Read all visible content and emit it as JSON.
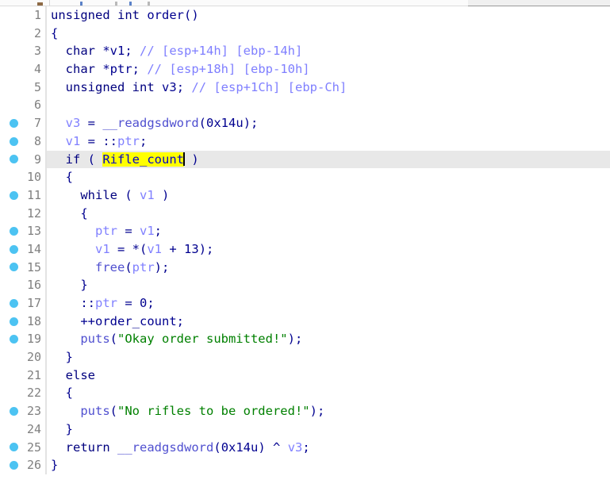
{
  "window": {
    "title": "Decompiler pseudocode view",
    "top_toolbar_visible_sliver": true
  },
  "editor": {
    "highlighted_token": "Rifle_count",
    "current_line": 9,
    "caret_after_token": true,
    "colors": {
      "background": "#ffffff",
      "current_line_highlight": "#e8e8e8",
      "breakpoint_dot": "#4cc3f2",
      "line_number": "#808080",
      "keyword": "#00007f",
      "local_variable": "#8080ff",
      "global_variable": "#8080ff",
      "function_name": "#5050d0",
      "string_literal": "#008000",
      "comment": "#7f7fff",
      "selection_highlight_bg": "#ffff00",
      "selection_highlight_fg": "#0000cc",
      "gutter_rule": "#e3e3e3"
    },
    "lines": [
      {
        "n": "1",
        "bp": false,
        "current": false,
        "tokens": [
          {
            "t": "unsigned",
            "c": "kw"
          },
          {
            "t": " ",
            "c": "plain"
          },
          {
            "t": "int",
            "c": "kw"
          },
          {
            "t": " ",
            "c": "plain"
          },
          {
            "t": "order",
            "c": "plain"
          },
          {
            "t": "()",
            "c": "punct"
          }
        ]
      },
      {
        "n": "2",
        "bp": false,
        "current": false,
        "tokens": [
          {
            "t": "{",
            "c": "punct"
          }
        ]
      },
      {
        "n": "3",
        "bp": false,
        "current": false,
        "tokens": [
          {
            "t": "  ",
            "c": "plain"
          },
          {
            "t": "char",
            "c": "kw"
          },
          {
            "t": " *",
            "c": "punct"
          },
          {
            "t": "v1",
            "c": "plain"
          },
          {
            "t": "; ",
            "c": "punct"
          },
          {
            "t": "// [esp+14h] [ebp-14h]",
            "c": "cmt"
          }
        ]
      },
      {
        "n": "4",
        "bp": false,
        "current": false,
        "tokens": [
          {
            "t": "  ",
            "c": "plain"
          },
          {
            "t": "char",
            "c": "kw"
          },
          {
            "t": " *",
            "c": "punct"
          },
          {
            "t": "ptr",
            "c": "plain"
          },
          {
            "t": "; ",
            "c": "punct"
          },
          {
            "t": "// [esp+18h] [ebp-10h]",
            "c": "cmt"
          }
        ]
      },
      {
        "n": "5",
        "bp": false,
        "current": false,
        "tokens": [
          {
            "t": "  ",
            "c": "plain"
          },
          {
            "t": "unsigned",
            "c": "kw"
          },
          {
            "t": " ",
            "c": "plain"
          },
          {
            "t": "int",
            "c": "kw"
          },
          {
            "t": " ",
            "c": "plain"
          },
          {
            "t": "v3",
            "c": "plain"
          },
          {
            "t": "; ",
            "c": "punct"
          },
          {
            "t": "// [esp+1Ch] [ebp-Ch]",
            "c": "cmt"
          }
        ]
      },
      {
        "n": "6",
        "bp": false,
        "current": false,
        "tokens": []
      },
      {
        "n": "7",
        "bp": true,
        "current": false,
        "tokens": [
          {
            "t": "  ",
            "c": "plain"
          },
          {
            "t": "v3",
            "c": "lvar"
          },
          {
            "t": " = ",
            "c": "punct"
          },
          {
            "t": "__readgsdword",
            "c": "func"
          },
          {
            "t": "(",
            "c": "punct"
          },
          {
            "t": "0x14u",
            "c": "num"
          },
          {
            "t": ");",
            "c": "punct"
          }
        ]
      },
      {
        "n": "8",
        "bp": true,
        "current": false,
        "tokens": [
          {
            "t": "  ",
            "c": "plain"
          },
          {
            "t": "v1",
            "c": "lvar"
          },
          {
            "t": " = ",
            "c": "punct"
          },
          {
            "t": "::",
            "c": "punct"
          },
          {
            "t": "ptr",
            "c": "gvar"
          },
          {
            "t": ";",
            "c": "punct"
          }
        ]
      },
      {
        "n": "9",
        "bp": true,
        "current": true,
        "tokens": [
          {
            "t": "  ",
            "c": "plain"
          },
          {
            "t": "if",
            "c": "kw"
          },
          {
            "t": " ( ",
            "c": "punct"
          },
          {
            "t": "Rifle_count",
            "c": "hl"
          },
          {
            "t": "CARET",
            "c": "caret"
          },
          {
            "t": " )",
            "c": "punct"
          }
        ]
      },
      {
        "n": "10",
        "bp": false,
        "current": false,
        "tokens": [
          {
            "t": "  {",
            "c": "punct"
          }
        ]
      },
      {
        "n": "11",
        "bp": true,
        "current": false,
        "tokens": [
          {
            "t": "    ",
            "c": "plain"
          },
          {
            "t": "while",
            "c": "kw"
          },
          {
            "t": " ( ",
            "c": "punct"
          },
          {
            "t": "v1",
            "c": "lvar"
          },
          {
            "t": " )",
            "c": "punct"
          }
        ]
      },
      {
        "n": "12",
        "bp": false,
        "current": false,
        "tokens": [
          {
            "t": "    {",
            "c": "punct"
          }
        ]
      },
      {
        "n": "13",
        "bp": true,
        "current": false,
        "tokens": [
          {
            "t": "      ",
            "c": "plain"
          },
          {
            "t": "ptr",
            "c": "lvar"
          },
          {
            "t": " = ",
            "c": "punct"
          },
          {
            "t": "v1",
            "c": "lvar"
          },
          {
            "t": ";",
            "c": "punct"
          }
        ]
      },
      {
        "n": "14",
        "bp": true,
        "current": false,
        "tokens": [
          {
            "t": "      ",
            "c": "plain"
          },
          {
            "t": "v1",
            "c": "lvar"
          },
          {
            "t": " = *(",
            "c": "punct"
          },
          {
            "t": "v1",
            "c": "lvar"
          },
          {
            "t": " + ",
            "c": "punct"
          },
          {
            "t": "13",
            "c": "num"
          },
          {
            "t": ");",
            "c": "punct"
          }
        ]
      },
      {
        "n": "15",
        "bp": true,
        "current": false,
        "tokens": [
          {
            "t": "      ",
            "c": "plain"
          },
          {
            "t": "free",
            "c": "func"
          },
          {
            "t": "(",
            "c": "punct"
          },
          {
            "t": "ptr",
            "c": "lvar"
          },
          {
            "t": ");",
            "c": "punct"
          }
        ]
      },
      {
        "n": "16",
        "bp": false,
        "current": false,
        "tokens": [
          {
            "t": "    }",
            "c": "punct"
          }
        ]
      },
      {
        "n": "17",
        "bp": true,
        "current": false,
        "tokens": [
          {
            "t": "    ",
            "c": "plain"
          },
          {
            "t": "::",
            "c": "punct"
          },
          {
            "t": "ptr",
            "c": "gvar"
          },
          {
            "t": " = ",
            "c": "punct"
          },
          {
            "t": "0",
            "c": "num"
          },
          {
            "t": ";",
            "c": "punct"
          }
        ]
      },
      {
        "n": "18",
        "bp": true,
        "current": false,
        "tokens": [
          {
            "t": "    ++",
            "c": "punct"
          },
          {
            "t": "order_count",
            "c": "plain"
          },
          {
            "t": ";",
            "c": "punct"
          }
        ]
      },
      {
        "n": "19",
        "bp": true,
        "current": false,
        "tokens": [
          {
            "t": "    ",
            "c": "plain"
          },
          {
            "t": "puts",
            "c": "func"
          },
          {
            "t": "(",
            "c": "punct"
          },
          {
            "t": "\"Okay order submitted!\"",
            "c": "str"
          },
          {
            "t": ");",
            "c": "punct"
          }
        ]
      },
      {
        "n": "20",
        "bp": false,
        "current": false,
        "tokens": [
          {
            "t": "  }",
            "c": "punct"
          }
        ]
      },
      {
        "n": "21",
        "bp": false,
        "current": false,
        "tokens": [
          {
            "t": "  ",
            "c": "plain"
          },
          {
            "t": "else",
            "c": "kw"
          }
        ]
      },
      {
        "n": "22",
        "bp": false,
        "current": false,
        "tokens": [
          {
            "t": "  {",
            "c": "punct"
          }
        ]
      },
      {
        "n": "23",
        "bp": true,
        "current": false,
        "tokens": [
          {
            "t": "    ",
            "c": "plain"
          },
          {
            "t": "puts",
            "c": "func"
          },
          {
            "t": "(",
            "c": "punct"
          },
          {
            "t": "\"No rifles to be ordered!\"",
            "c": "str"
          },
          {
            "t": ");",
            "c": "punct"
          }
        ]
      },
      {
        "n": "24",
        "bp": false,
        "current": false,
        "tokens": [
          {
            "t": "  }",
            "c": "punct"
          }
        ]
      },
      {
        "n": "25",
        "bp": true,
        "current": false,
        "tokens": [
          {
            "t": "  ",
            "c": "plain"
          },
          {
            "t": "return",
            "c": "kw"
          },
          {
            "t": " ",
            "c": "plain"
          },
          {
            "t": "__readgsdword",
            "c": "func"
          },
          {
            "t": "(",
            "c": "punct"
          },
          {
            "t": "0x14u",
            "c": "num"
          },
          {
            "t": ") ^ ",
            "c": "punct"
          },
          {
            "t": "v3",
            "c": "lvar"
          },
          {
            "t": ";",
            "c": "punct"
          }
        ]
      },
      {
        "n": "26",
        "bp": true,
        "current": false,
        "tokens": [
          {
            "t": "}",
            "c": "punct"
          }
        ]
      }
    ]
  }
}
